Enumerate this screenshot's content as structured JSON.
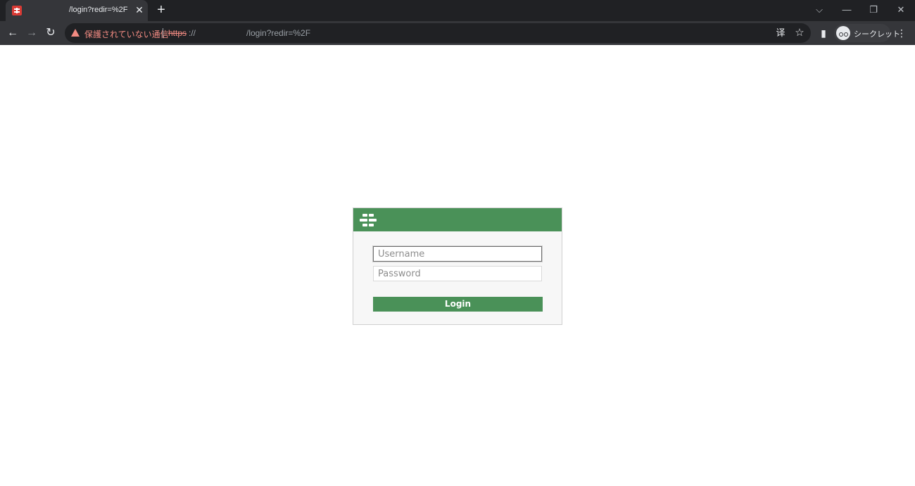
{
  "browser": {
    "tab": {
      "title": "/login?redir=%2F",
      "close_glyph": "✕",
      "favicon": "fortinet-favicon-icon"
    },
    "new_tab_glyph": "+",
    "window_controls": {
      "tab_search": "⌵",
      "minimize": "—",
      "restore": "❐",
      "close": "✕"
    },
    "nav": {
      "back": "←",
      "forward": "→",
      "reload": "↻"
    },
    "omnibox": {
      "security_warning": "保護されていない通信",
      "url_scheme": "https",
      "url_separator": "://",
      "url_path": "/login?redir=%2F"
    },
    "toolbar_icons": {
      "translate": "译",
      "bookmark": "☆",
      "side_panel": "▮",
      "menu": "⋮"
    },
    "profile": {
      "label": "シークレット"
    }
  },
  "login": {
    "username_placeholder": "Username",
    "password_placeholder": "Password",
    "login_button": "Login"
  },
  "colors": {
    "accent": "#4a9158",
    "warning": "#f28b82",
    "chrome_dark": "#202124",
    "chrome_toolbar": "#35363a"
  }
}
